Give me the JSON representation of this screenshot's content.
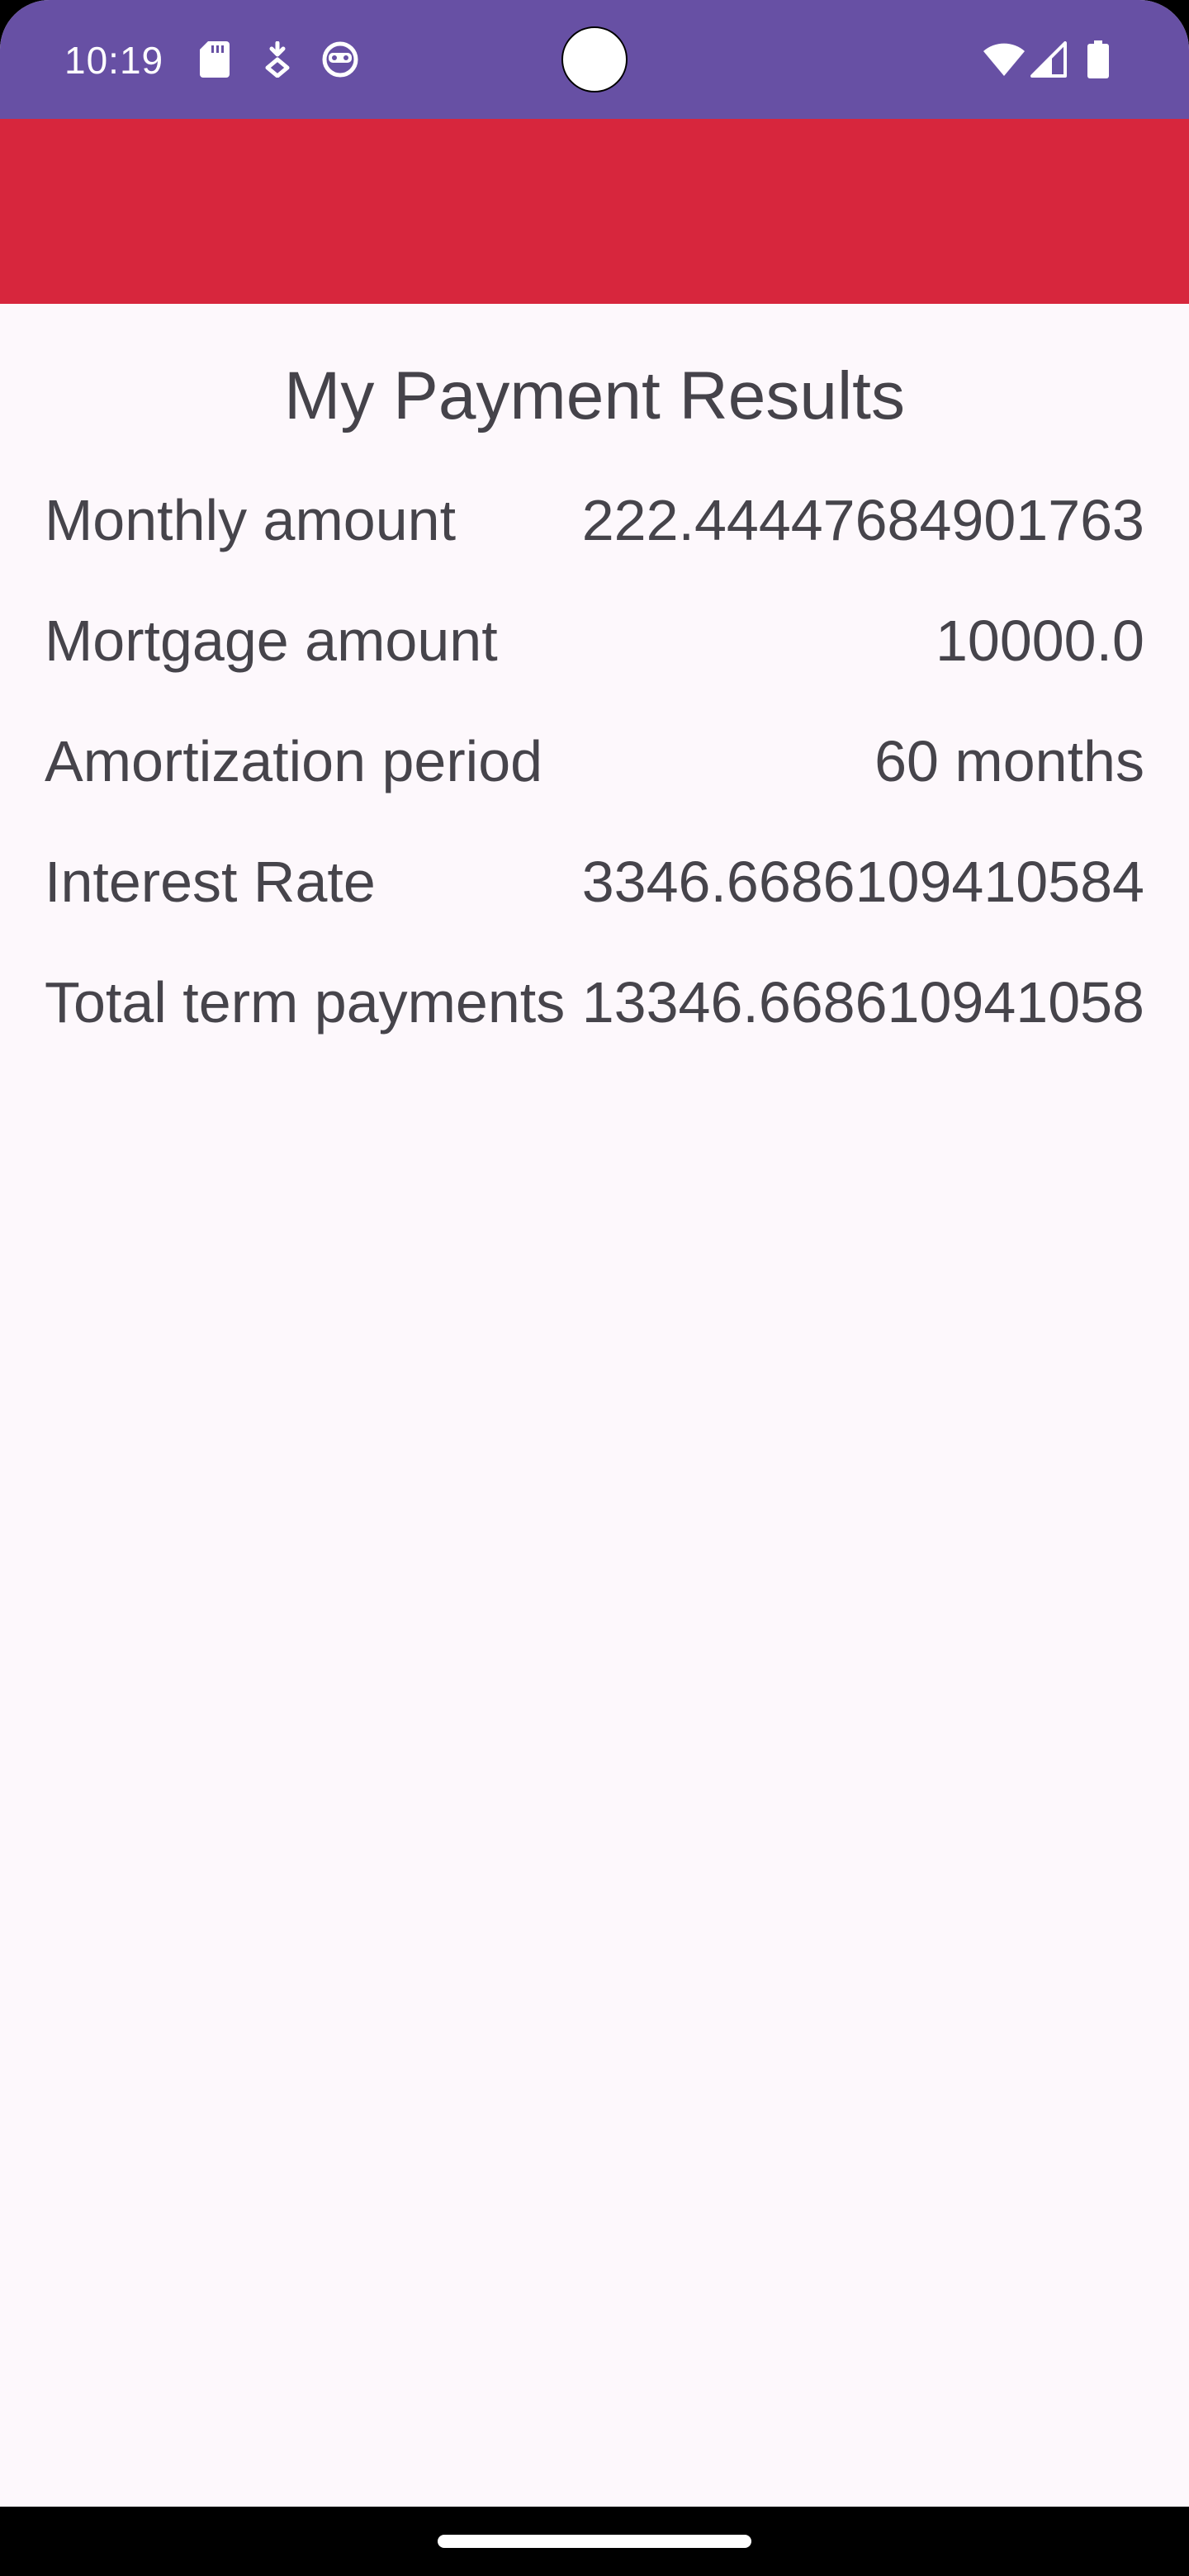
{
  "status_bar": {
    "time": "10:19",
    "left_icons": [
      "sd-card-icon",
      "download-indicator-icon",
      "face-icon"
    ],
    "right_icons": [
      "wifi-icon",
      "cell-signal-icon",
      "battery-icon"
    ]
  },
  "app_bar": {
    "color": "#d7263d"
  },
  "page": {
    "title": "My Payment Results"
  },
  "results": [
    {
      "label": "Monthly amount",
      "value": "222.44447684901763"
    },
    {
      "label": "Mortgage amount",
      "value": "10000.0"
    },
    {
      "label": "Amortization period",
      "value": "60 months"
    },
    {
      "label": "Interest Rate",
      "value": "3346.6686109410584"
    },
    {
      "label": "Total term payments",
      "value": "13346.668610941058"
    }
  ],
  "colors": {
    "status_bar": "#6750a4",
    "app_bar": "#d7263d",
    "background": "#fdf8fc",
    "text": "#46444b"
  }
}
